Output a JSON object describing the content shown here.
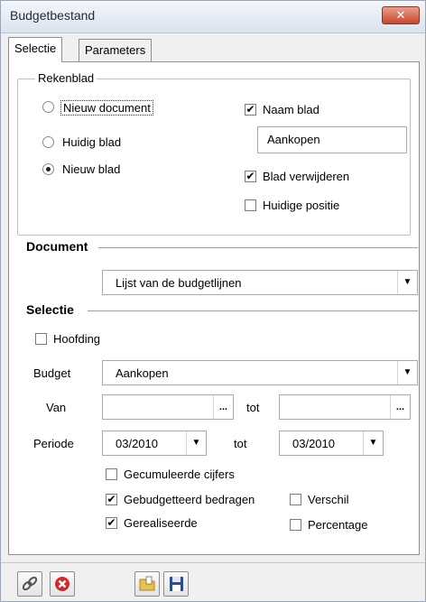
{
  "window": {
    "title": "Budgetbestand",
    "close_label": "✕"
  },
  "tabs": [
    {
      "label": "Selectie",
      "active": true
    },
    {
      "label": "Parameters",
      "active": false
    }
  ],
  "rekenblad": {
    "group_label": "Rekenblad",
    "options": [
      {
        "label": "Nieuw document",
        "selected": false
      },
      {
        "label": "Huidig blad",
        "selected": false
      },
      {
        "label": "Nieuw blad",
        "selected": true
      }
    ],
    "naam_blad": {
      "label": "Naam blad",
      "checked": true,
      "value": "Aankopen"
    },
    "blad_verwijderen": {
      "label": "Blad verwijderen",
      "checked": true
    },
    "huidige_positie": {
      "label": "Huidige positie",
      "checked": false
    }
  },
  "document": {
    "title": "Document",
    "selected": "Lijst van de budgetlijnen"
  },
  "selectie": {
    "title": "Selectie",
    "hoofding": {
      "label": "Hoofding",
      "checked": false
    },
    "budget": {
      "label": "Budget",
      "value": "Aankopen"
    },
    "van": {
      "label": "Van",
      "value": "",
      "browse": "...",
      "tot_label": "tot",
      "tot_value": ""
    },
    "periode": {
      "label": "Periode",
      "value": "03/2010",
      "tot_label": "tot",
      "tot_value": "03/2010"
    },
    "options": {
      "gecumuleerde": {
        "label": "Gecumuleerde cijfers",
        "checked": false
      },
      "gebudgetteerd": {
        "label": "Gebudgetteerd bedragen",
        "checked": true
      },
      "gerealiseerde": {
        "label": "Gerealiseerde",
        "checked": true
      },
      "verschil": {
        "label": "Verschil",
        "checked": false
      },
      "percentage": {
        "label": "Percentage",
        "checked": false
      }
    }
  },
  "check_mark": "✔",
  "arrow_glyph": "▼"
}
